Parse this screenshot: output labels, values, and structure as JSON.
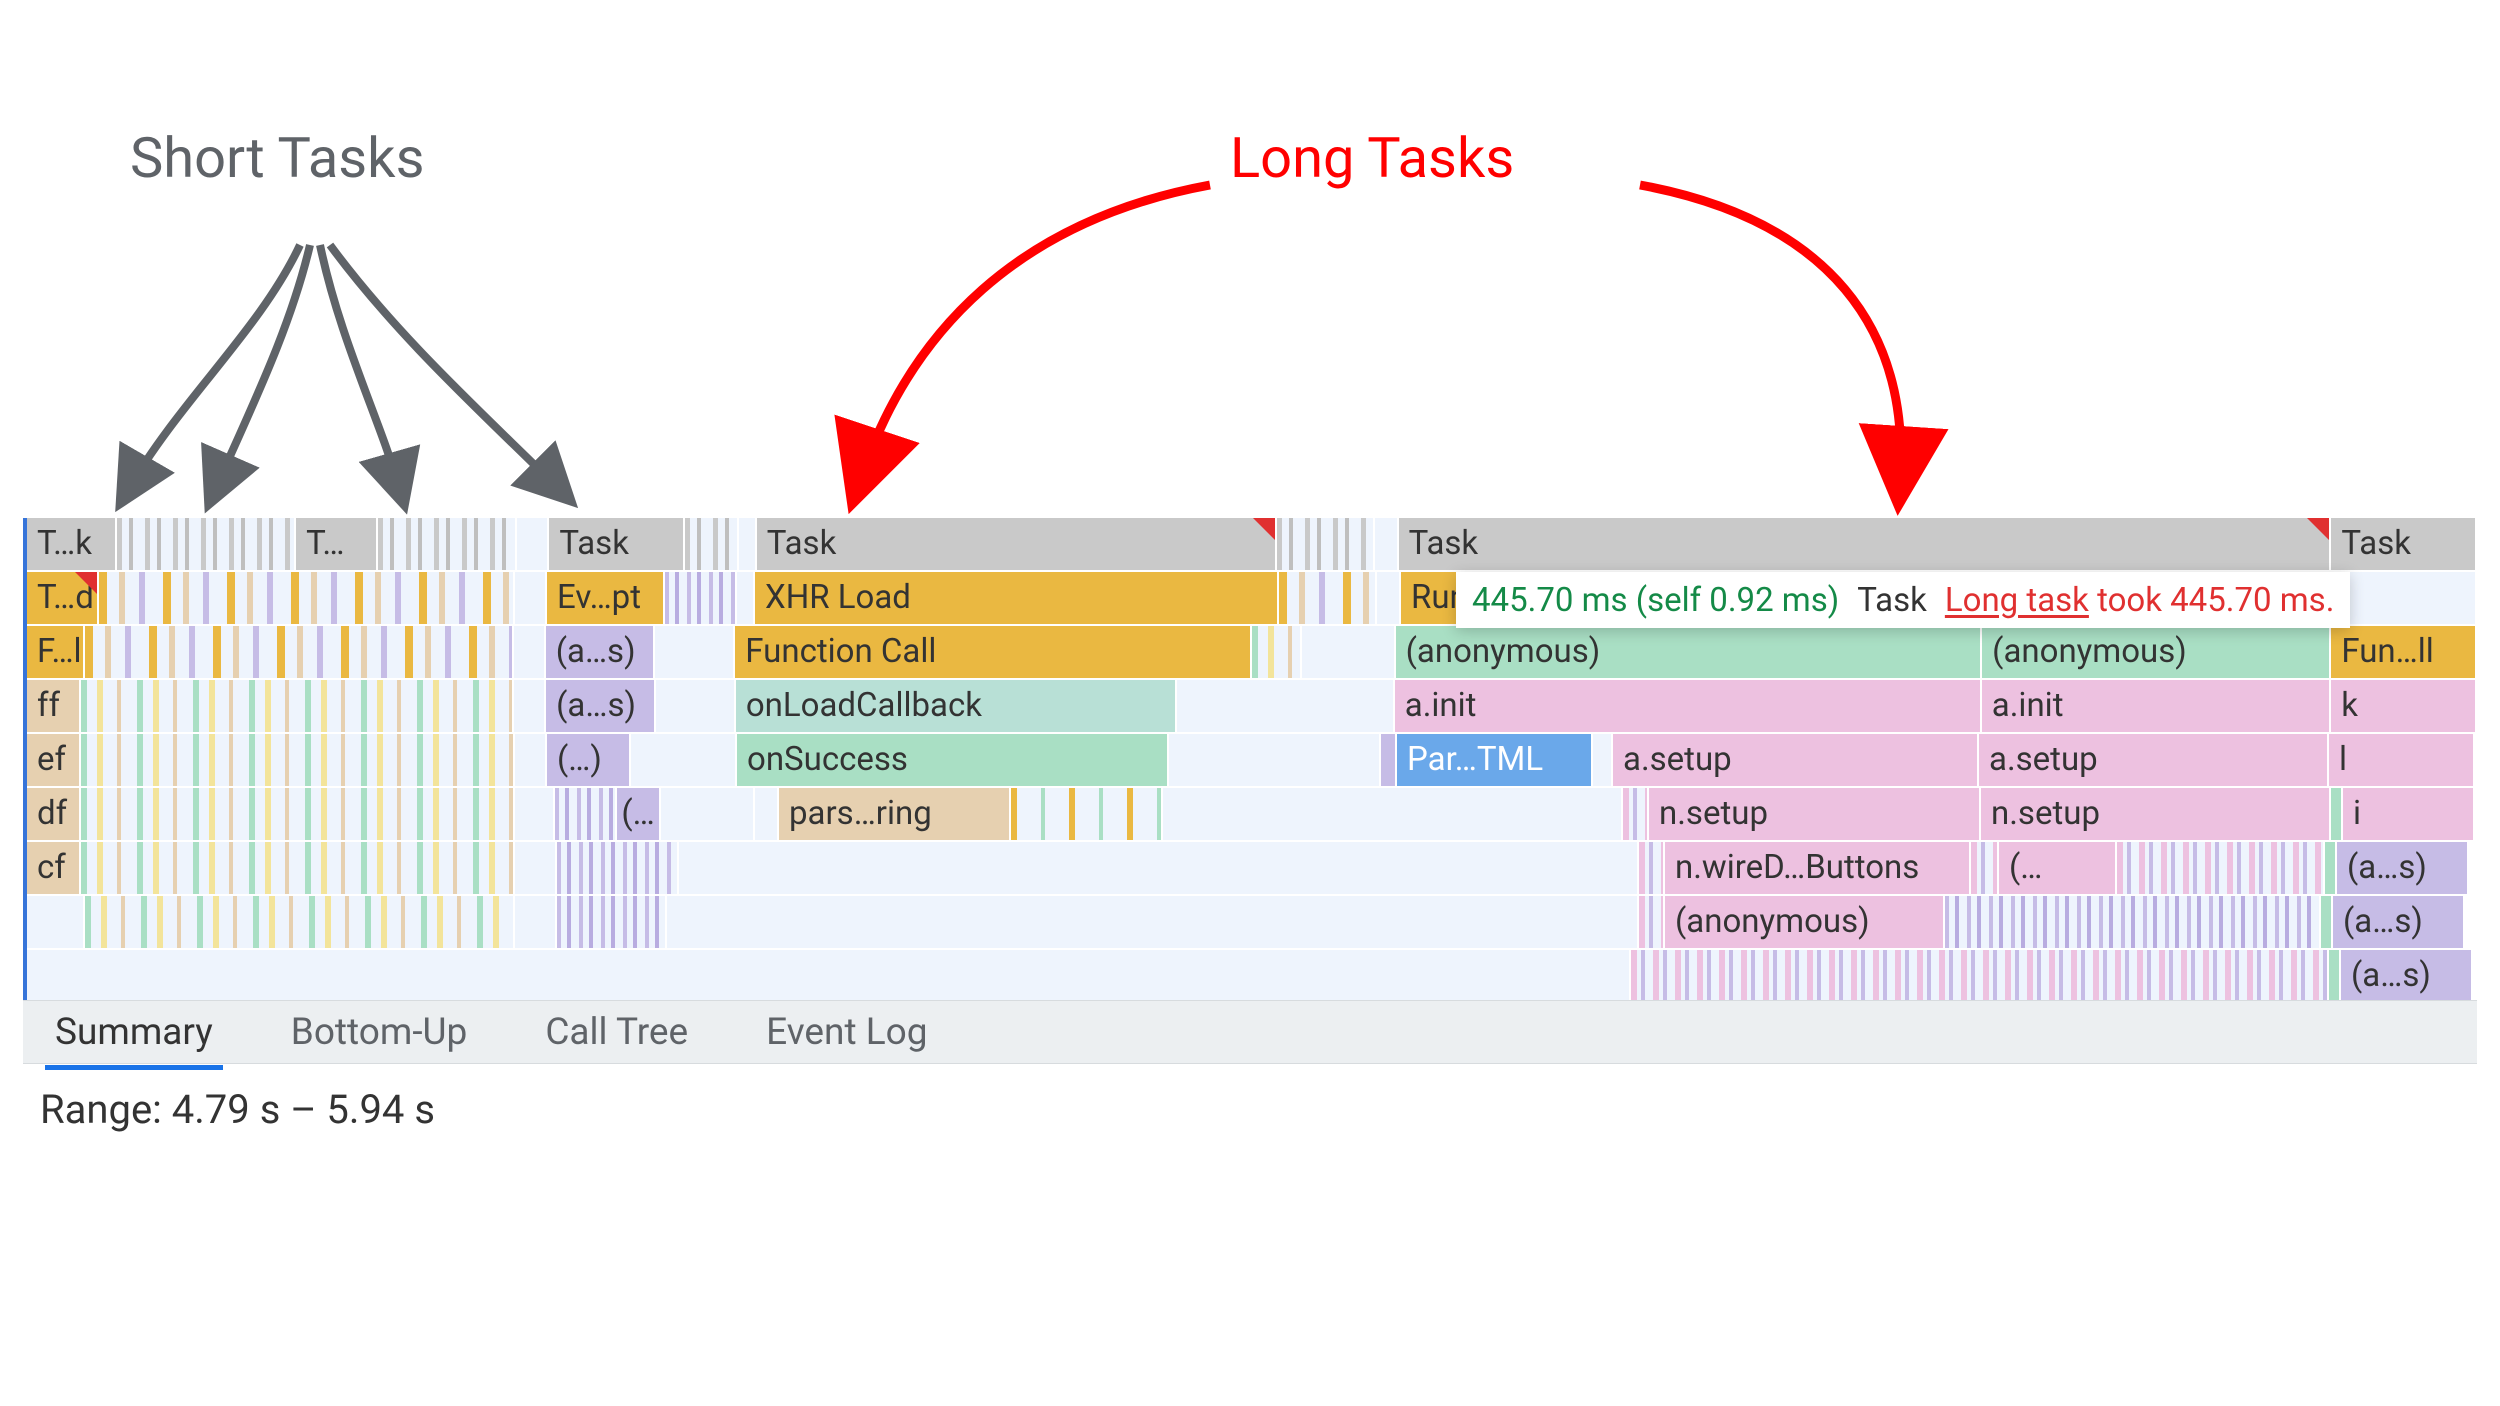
{
  "annotations": {
    "short_label": "Short Tasks",
    "long_label": "Long Tasks"
  },
  "tooltip": {
    "time_self": "445.70 ms (self 0.92 ms)",
    "task_label": "Task",
    "link_text": "Long task",
    "took_text": "took 445.70 ms."
  },
  "flame": {
    "row0": {
      "c0": "T…k",
      "c1": "T…",
      "c2": "Task",
      "c3": "Task",
      "c4": "Task",
      "c5": "Task"
    },
    "row1": {
      "c0": "T…d",
      "c1": "Ev…pt",
      "c2": "XHR Load",
      "c3": "Run"
    },
    "row2": {
      "c0": "F…l",
      "c1": "(a…s)",
      "c2": "Function Call",
      "c3": "(anonymous)",
      "c4": "(anonymous)",
      "c5": "Fun…ll"
    },
    "row3": {
      "c0": "ff",
      "c1": "(a…s)",
      "c2": "onLoadCallback",
      "c3": "a.init",
      "c4": "a.init",
      "c5": "k"
    },
    "row4": {
      "c0": "ef",
      "c1": "(…)",
      "c2": "onSuccess",
      "c3": "Par…TML",
      "c4": "a.setup",
      "c5": "a.setup",
      "c6": "l"
    },
    "row5": {
      "c0": "df",
      "c1": "(…",
      "c2": "pars…ring",
      "c3": "n.setup",
      "c4": "n.setup",
      "c5": "i"
    },
    "row6": {
      "c0": "cf",
      "c1": "n.wireD…Buttons",
      "c2": "(…",
      "c3": "(a…s)"
    },
    "row7": {
      "c0": "(anonymous)",
      "c1": "(a…s)"
    },
    "row8": {
      "c0": "(a…s)"
    }
  },
  "tabs": {
    "summary": "Summary",
    "bottom_up": "Bottom-Up",
    "call_tree": "Call Tree",
    "event_log": "Event Log"
  },
  "range": "Range: 4.79 s – 5.94 s",
  "colors": {
    "accent_red": "#ff0000",
    "accent_blue": "#1a73e8",
    "gray_text": "#5f6368"
  }
}
